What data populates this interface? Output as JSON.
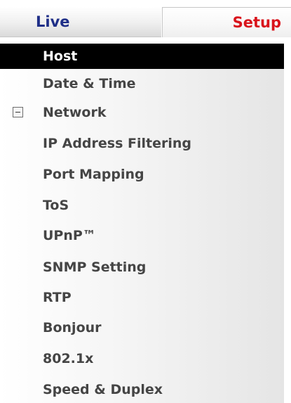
{
  "tabs": {
    "live": "Live",
    "setup": "Setup"
  },
  "menu": {
    "items": [
      {
        "label": "Host"
      },
      {
        "label": "Date & Time"
      },
      {
        "label": "Network"
      },
      {
        "label": "IP Address Filtering"
      },
      {
        "label": "Port Mapping"
      },
      {
        "label": "ToS"
      },
      {
        "label": "UPnP™"
      },
      {
        "label": "SNMP Setting"
      },
      {
        "label": "RTP"
      },
      {
        "label": "Bonjour"
      },
      {
        "label": "802.1x"
      },
      {
        "label": "Speed & Duplex"
      }
    ]
  },
  "icons": {
    "network_toggle": "minus-square-icon"
  },
  "colors": {
    "live_tab_text": "#1f2f88",
    "setup_tab_text": "#d9141c",
    "selected_item_bg": "#000000",
    "selected_item_text": "#ffffff",
    "item_text": "#454545"
  }
}
